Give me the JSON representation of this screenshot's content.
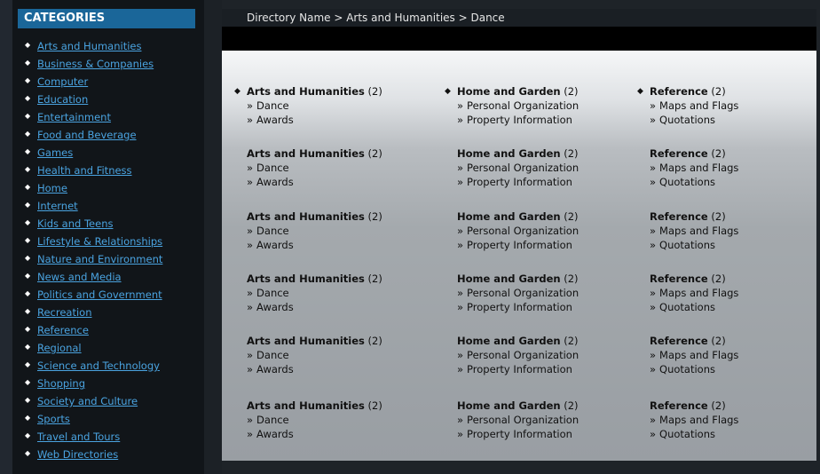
{
  "sidebar": {
    "header": "CATEGORIES",
    "bullet": "◆",
    "items": [
      "Arts and Humanities",
      "Business & Companies",
      "Computer",
      "Education",
      "Entertainment",
      "Food and Beverage",
      "Games",
      "Health and Fitness",
      "Home",
      "Internet",
      "Kids and Teens",
      "Lifestyle & Relationships",
      "Nature and Environment",
      "News and Media",
      "Politics and Government",
      "Recreation",
      "Reference",
      "Regional",
      "Science and Technology",
      "Shopping",
      "Society and Culture",
      "Sports",
      "Travel and Tours",
      "Web Directories"
    ]
  },
  "breadcrumb": "Directory Name > Arts and Humanities > Dance",
  "directory": {
    "bullet": "◆",
    "sub_bullet": "»",
    "rows": [
      [
        {
          "name": "Arts and Humanities",
          "count": "(2)",
          "subs": [
            "Dance",
            "Awards"
          ]
        },
        {
          "name": "Home and Garden",
          "count": "(2)",
          "subs": [
            "Personal Organization",
            "Property Information"
          ]
        },
        {
          "name": "Reference",
          "count": "(2)",
          "subs": [
            "Maps and Flags",
            "Quotations"
          ]
        }
      ],
      [
        {
          "name": "Arts and Humanities",
          "count": "(2)",
          "subs": [
            "Dance",
            "Awards"
          ]
        },
        {
          "name": "Home and Garden",
          "count": "(2)",
          "subs": [
            "Personal Organization",
            "Property Information"
          ]
        },
        {
          "name": "Reference",
          "count": "(2)",
          "subs": [
            "Maps and Flags",
            "Quotations"
          ]
        }
      ],
      [
        {
          "name": "Arts and Humanities",
          "count": "(2)",
          "subs": [
            "Dance",
            "Awards"
          ]
        },
        {
          "name": "Home and Garden",
          "count": "(2)",
          "subs": [
            "Personal Organization",
            "Property Information"
          ]
        },
        {
          "name": "Reference",
          "count": "(2)",
          "subs": [
            "Maps and Flags",
            "Quotations"
          ]
        }
      ],
      [
        {
          "name": "Arts and Humanities",
          "count": "(2)",
          "subs": [
            "Dance",
            "Awards"
          ]
        },
        {
          "name": "Home and Garden",
          "count": "(2)",
          "subs": [
            "Personal Organization",
            "Property Information"
          ]
        },
        {
          "name": "Reference",
          "count": "(2)",
          "subs": [
            "Maps and Flags",
            "Quotations"
          ]
        }
      ],
      [
        {
          "name": "Arts and Humanities",
          "count": "(2)",
          "subs": [
            "Dance",
            "Awards"
          ]
        },
        {
          "name": "Home and Garden",
          "count": "(2)",
          "subs": [
            "Personal Organization",
            "Property Information"
          ]
        },
        {
          "name": "Reference",
          "count": "(2)",
          "subs": [
            "Maps and Flags",
            "Quotations"
          ]
        }
      ],
      [
        {
          "name": "Arts and Humanities",
          "count": "(2)",
          "subs": [
            "Dance",
            "Awards"
          ]
        },
        {
          "name": "Home and Garden",
          "count": "(2)",
          "subs": [
            "Personal Organization",
            "Property Information"
          ]
        },
        {
          "name": "Reference",
          "count": "(2)",
          "subs": [
            "Maps and Flags",
            "Quotations"
          ]
        }
      ]
    ]
  },
  "colors": {
    "header_bg": "#1a6699",
    "link": "#4aa3e0",
    "sidebar_bg": "#111519"
  }
}
